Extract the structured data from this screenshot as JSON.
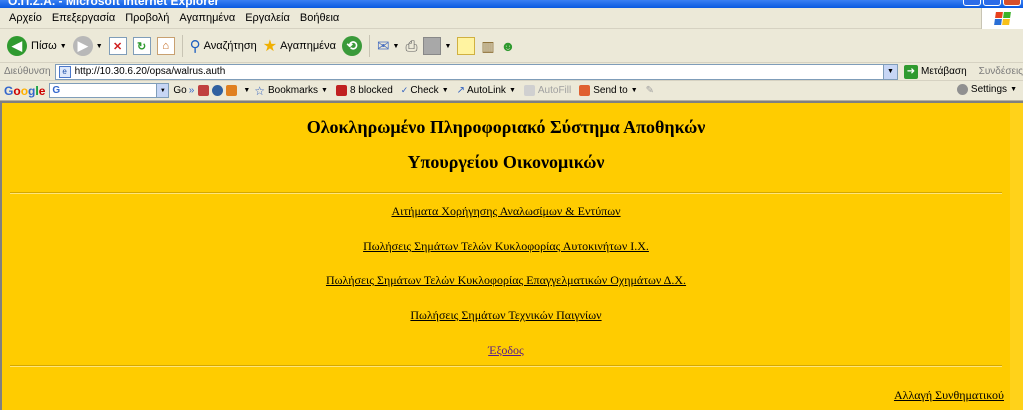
{
  "window": {
    "title": "Ο.Π.Σ.Α. - Microsoft Internet Explorer"
  },
  "menu": {
    "items": [
      "Αρχείο",
      "Επεξεργασία",
      "Προβολή",
      "Αγαπημένα",
      "Εργαλεία",
      "Βοήθεια"
    ]
  },
  "toolbar": {
    "back_label": "Πίσω",
    "search_label": "Αναζήτηση",
    "favorites_label": "Αγαπημένα"
  },
  "address_bar": {
    "label": "Διεύθυνση",
    "url": "http://10.30.6.20/opsa/walrus.auth",
    "go_label": "Μετάβαση",
    "links_label": "Συνδέσεις"
  },
  "google_toolbar": {
    "logo": "Google",
    "go_label": "Go",
    "bookmarks_label": "Bookmarks",
    "blocked_label": "8 blocked",
    "check_label": "Check",
    "autolink_label": "AutoLink",
    "autofill_label": "AutoFill",
    "sendto_label": "Send to",
    "settings_label": "Settings"
  },
  "page": {
    "title_line1": "Ολοκληρωμένο Πληροφοριακό Σύστημα Αποθηκών",
    "title_line2": "Υπουργείου Οικονομικών",
    "links": [
      "Αιτήματα Χορήγησης Αναλωσίμων & Εντύπων",
      "Πωλήσεις Σημάτων Τελών Κυκλοφορίας Αυτοκινήτων Ι.Χ.",
      "Πωλήσεις Σημάτων Τελών Κυκλοφορίας Επαγγελματικών Οχημάτων Δ.Χ.",
      "Πωλήσεις Σημάτων Τεχνικών Παιγνίων",
      "Έξοδος"
    ],
    "change_password": "Αλλαγή Συνθηματικού"
  },
  "colors": {
    "page_background": "#ffcc00",
    "visited_link": "#551a8b"
  }
}
